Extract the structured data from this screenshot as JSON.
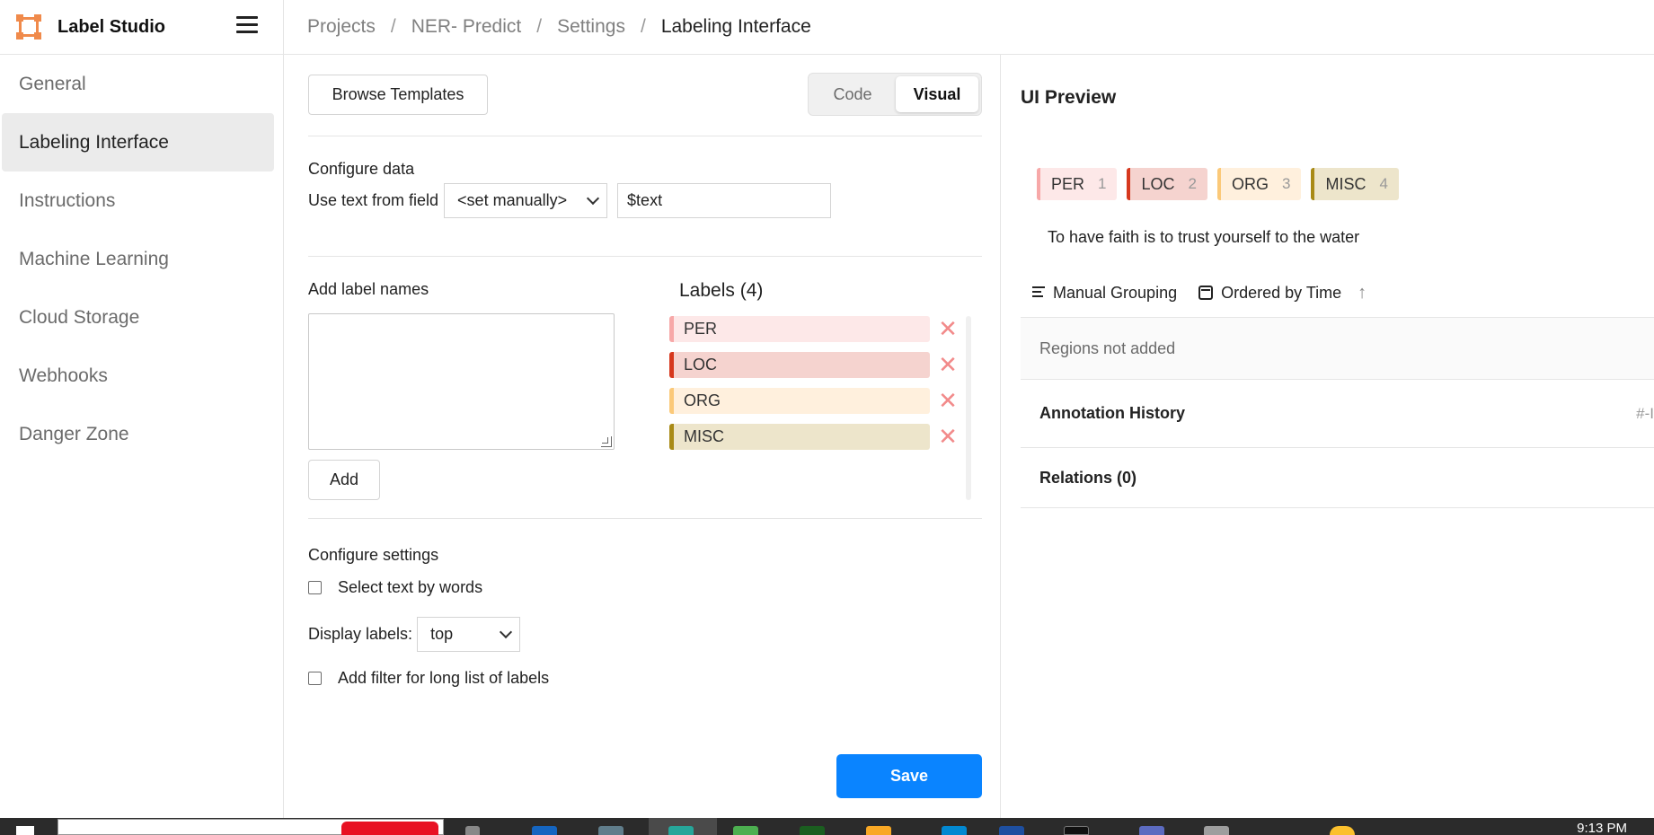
{
  "app": {
    "name": "Label Studio"
  },
  "breadcrumb": [
    "Projects",
    "NER- Predict",
    "Settings",
    "Labeling Interface"
  ],
  "sidebar": {
    "items": [
      {
        "label": "General",
        "active": false
      },
      {
        "label": "Labeling Interface",
        "active": true
      },
      {
        "label": "Instructions",
        "active": false
      },
      {
        "label": "Machine Learning",
        "active": false
      },
      {
        "label": "Cloud Storage",
        "active": false
      },
      {
        "label": "Webhooks",
        "active": false
      },
      {
        "label": "Danger Zone",
        "active": false
      }
    ]
  },
  "config": {
    "browse_label": "Browse Templates",
    "mode_code": "Code",
    "mode_visual": "Visual",
    "mode_selected": "Visual",
    "configure_data_title": "Configure data",
    "use_text_from_field": "Use text from field",
    "field_select_value": "<set manually>",
    "field_value": "$text",
    "add_label_names_title": "Add label names",
    "add_label_names_value": "",
    "add_button": "Add",
    "labels_title": "Labels (4)",
    "labels": [
      {
        "name": "PER",
        "bar": "#f7a8a8",
        "bg": "#fde8e8"
      },
      {
        "name": "LOC",
        "bar": "#d6381e",
        "bg": "#f5d3cf"
      },
      {
        "name": "ORG",
        "bar": "#fbc979",
        "bg": "#fff0dd"
      },
      {
        "name": "MISC",
        "bar": "#a88a16",
        "bg": "#ede5cb"
      }
    ],
    "delete_icon": "close-icon",
    "configure_settings_title": "Configure settings",
    "select_by_words_label": "Select text by words",
    "select_by_words_checked": false,
    "display_labels_label": "Display labels:",
    "display_labels_value": "top",
    "filter_label": "Add filter for long list of labels",
    "filter_checked": false,
    "save_label": "Save",
    "accent": "#0a84ff"
  },
  "preview": {
    "title": "UI Preview",
    "chips": [
      {
        "name": "PER",
        "hotkey": "1",
        "bar": "#f7a8a8",
        "bg": "#fde8e8"
      },
      {
        "name": "LOC",
        "hotkey": "2",
        "bar": "#d6381e",
        "bg": "#f5d3cf"
      },
      {
        "name": "ORG",
        "hotkey": "3",
        "bar": "#fbc979",
        "bg": "#fff0dd"
      },
      {
        "name": "MISC",
        "hotkey": "4",
        "bar": "#a88a16",
        "bg": "#ede5cb"
      }
    ],
    "sample_text": "To have faith is to trust yourself to the water",
    "grouping_label": "Manual Grouping",
    "ordering_label": "Ordered by Time",
    "regions_empty": "Regions not added",
    "history_title": "Annotation History",
    "history_hint": "#-I",
    "relations_title": "Relations (0)"
  },
  "taskbar": {
    "clock": "9:13 PM"
  }
}
